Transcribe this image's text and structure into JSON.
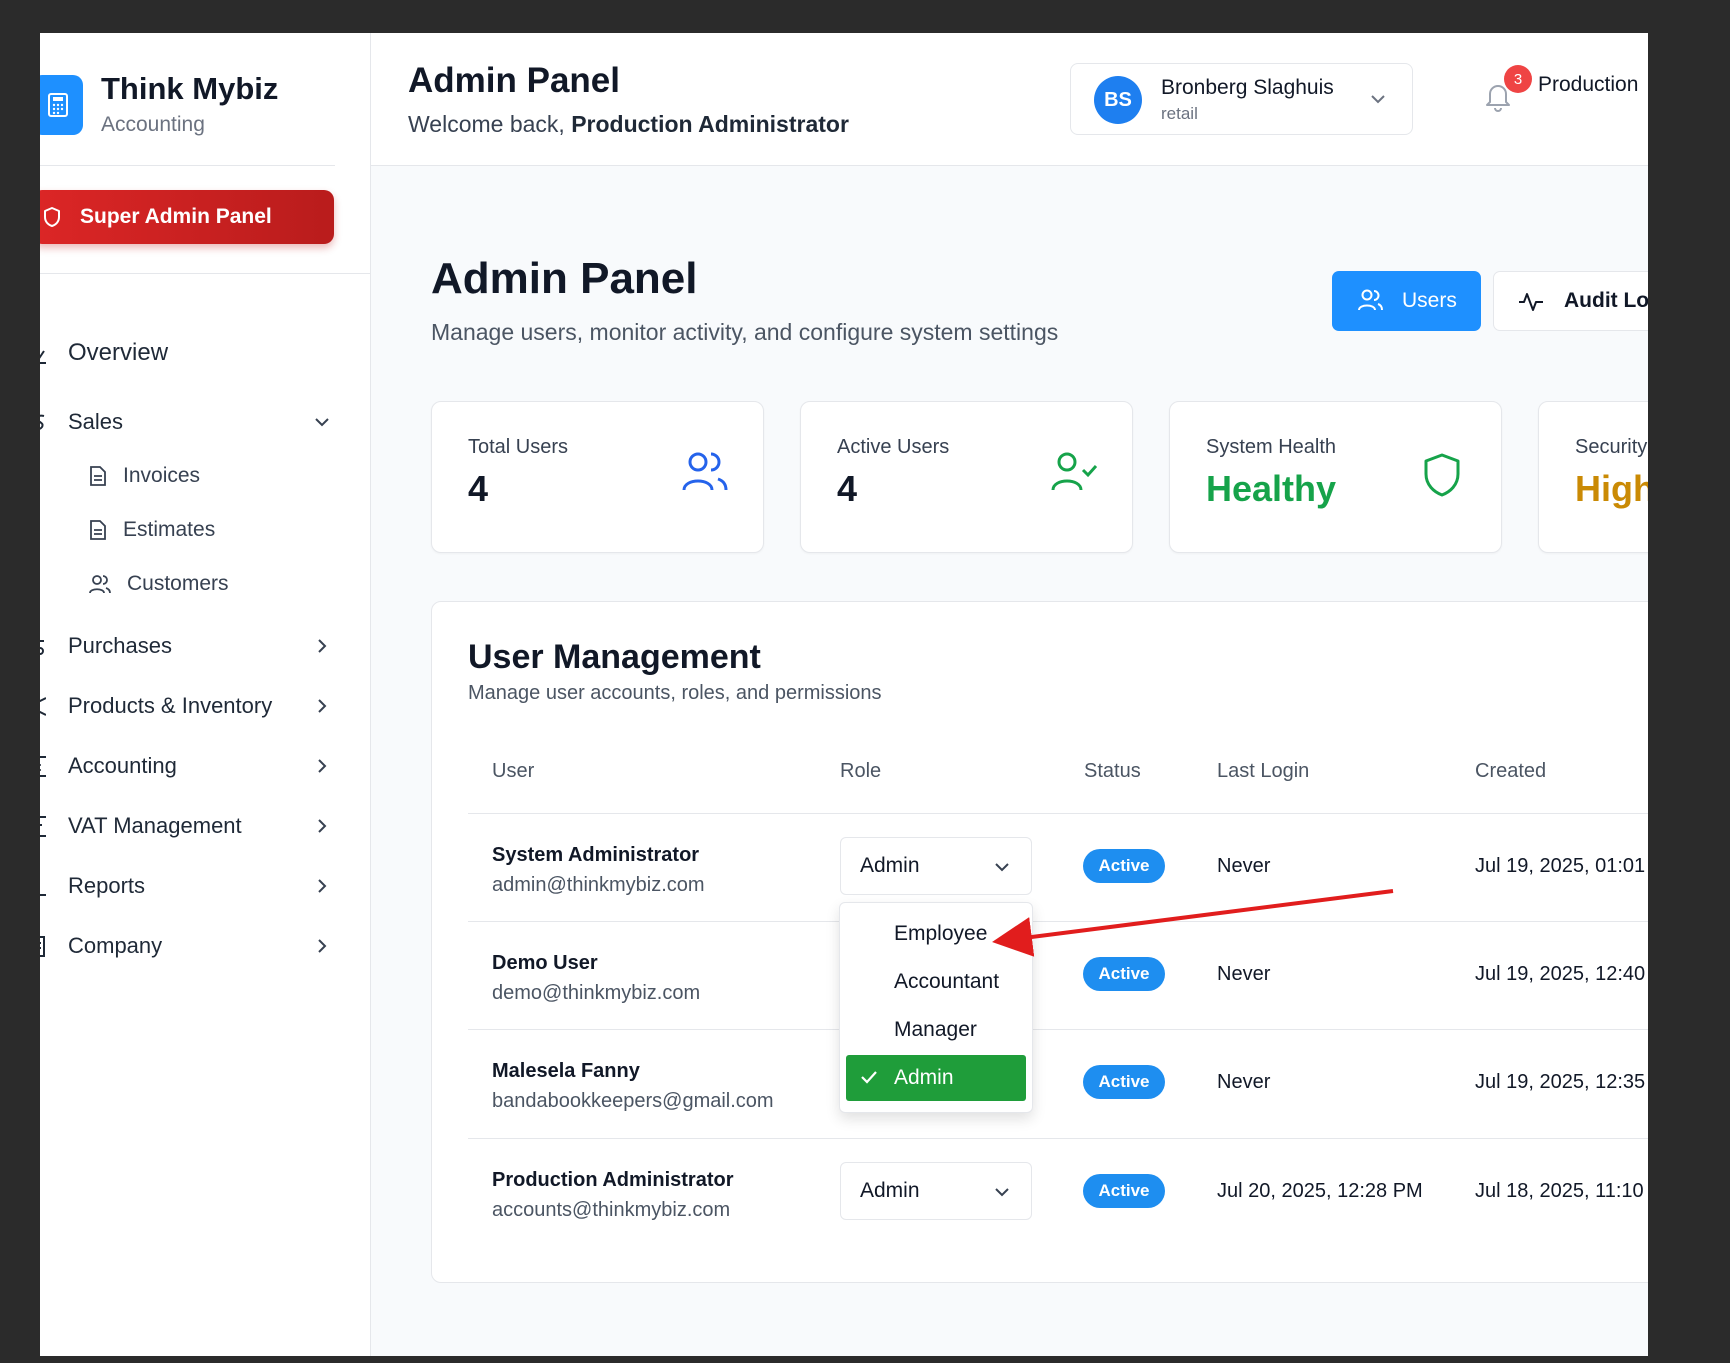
{
  "brand": {
    "name": "Think Mybiz",
    "subtitle": "Accounting"
  },
  "sidebar": {
    "super_admin_label": "Super Admin Panel",
    "items": [
      {
        "label": "Overview"
      },
      {
        "label": "Sales",
        "expanded": true,
        "children": [
          {
            "label": "Invoices"
          },
          {
            "label": "Estimates"
          },
          {
            "label": "Customers"
          }
        ]
      },
      {
        "label": "Purchases"
      },
      {
        "label": "Products & Inventory"
      },
      {
        "label": "Accounting"
      },
      {
        "label": "VAT Management"
      },
      {
        "label": "Reports"
      },
      {
        "label": "Company"
      }
    ]
  },
  "header": {
    "title": "Admin Panel",
    "welcome_prefix": "Welcome back, ",
    "welcome_name": "Production Administrator",
    "account": {
      "initials": "BS",
      "name": "Bronberg Slaghuis",
      "type": "retail"
    },
    "notifications": "3",
    "env_label": "Production"
  },
  "main": {
    "title": "Admin Panel",
    "subtitle": "Manage users, monitor activity, and configure system settings",
    "tabs": {
      "users": "Users",
      "audit": "Audit Logs"
    },
    "stats": [
      {
        "label": "Total Users",
        "value": "4"
      },
      {
        "label": "Active Users",
        "value": "4"
      },
      {
        "label": "System Health",
        "value": "Healthy"
      },
      {
        "label": "Security",
        "value": "High"
      }
    ]
  },
  "user_management": {
    "title": "User Management",
    "subtitle": "Manage user accounts, roles, and permissions",
    "columns": [
      "User",
      "Role",
      "Status",
      "Last Login",
      "Created"
    ],
    "rows": [
      {
        "name": "System Administrator",
        "email": "admin@thinkmybiz.com",
        "role": "Admin",
        "status": "Active",
        "last_login": "Never",
        "created": "Jul 19, 2025, 01:01"
      },
      {
        "name": "Demo User",
        "email": "demo@thinkmybiz.com",
        "role": "",
        "status": "Active",
        "last_login": "Never",
        "created": "Jul 19, 2025, 12:40"
      },
      {
        "name": "Malesela Fanny",
        "email": "bandabookkeepers@gmail.com",
        "role": "",
        "status": "Active",
        "last_login": "Never",
        "created": "Jul 19, 2025, 12:35"
      },
      {
        "name": "Production Administrator",
        "email": "accounts@thinkmybiz.com",
        "role": "Admin",
        "status": "Active",
        "last_login": "Jul 20, 2025, 12:28 PM",
        "created": "Jul 18, 2025, 11:10"
      }
    ],
    "role_options": [
      "Employee",
      "Accountant",
      "Manager",
      "Admin"
    ],
    "role_selected": "Admin"
  },
  "colors": {
    "primary": "#1e90ff",
    "danger": "#dc2626",
    "success": "#16a34a",
    "warning": "#ca8a04",
    "selected_option": "#1f9d3a",
    "annotation_arrow": "#e11d1d"
  }
}
